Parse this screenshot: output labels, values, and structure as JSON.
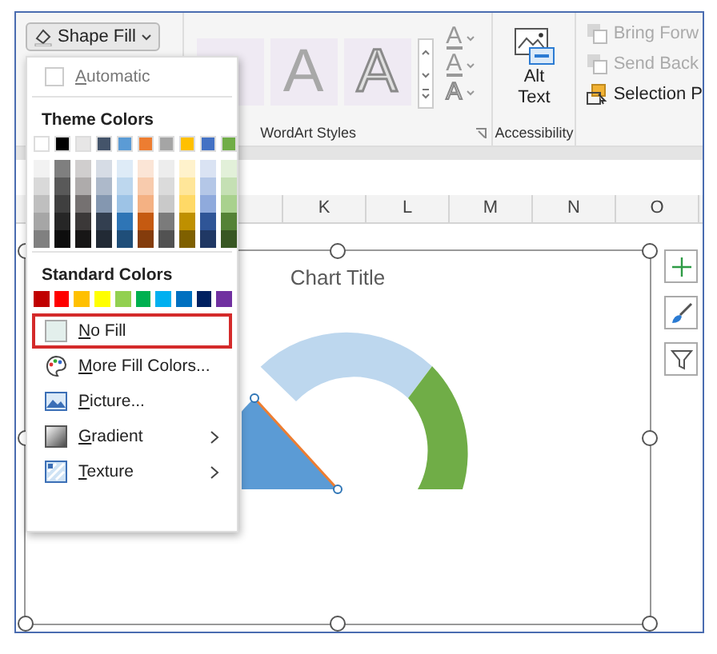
{
  "ribbon": {
    "shape_fill_button": {
      "label": "Shape Fill"
    },
    "wordart_tiles": [
      {
        "kind": "fill"
      },
      {
        "kind": "fill",
        "letter": "A"
      },
      {
        "kind": "outline",
        "letter": "A"
      }
    ],
    "text_effect_buttons": [
      {
        "letter": "A",
        "kind": "fill"
      },
      {
        "letter": "A",
        "kind": "outline"
      },
      {
        "letter": "A",
        "kind": "effects"
      }
    ],
    "group_labels": [
      "WordArt Styles",
      "Accessibility"
    ],
    "alt_text_button": {
      "lines": [
        "Alt",
        "Text"
      ]
    },
    "arrange_buttons": [
      {
        "label": "Bring Forw",
        "disabled": true
      },
      {
        "label": "Send Back",
        "disabled": true
      },
      {
        "label": "Selection P",
        "disabled": false
      }
    ]
  },
  "columns": [
    "K",
    "L",
    "M",
    "N",
    "O"
  ],
  "chart": {
    "title": "Chart Title"
  },
  "shape_fill_menu": {
    "automatic": {
      "label": "Automatic",
      "disabled": true
    },
    "theme_heading": "Theme Colors",
    "theme_colors": [
      {
        "color": "#ffffff",
        "shades": [
          {
            "color": "#f2f2f2"
          },
          {
            "color": "#d9d9d9"
          },
          {
            "color": "#bfbfbf"
          },
          {
            "color": "#a6a6a6"
          },
          {
            "color": "#808080"
          }
        ]
      },
      {
        "color": "#000000",
        "shades": [
          {
            "color": "#7f7f7f"
          },
          {
            "color": "#595959"
          },
          {
            "color": "#3f3f3f"
          },
          {
            "color": "#262626"
          },
          {
            "color": "#0d0d0d"
          }
        ]
      },
      {
        "color": "#e7e6e6",
        "shades": [
          {
            "color": "#d0cece"
          },
          {
            "color": "#aeabab"
          },
          {
            "color": "#757171"
          },
          {
            "color": "#3b3838"
          },
          {
            "color": "#171616"
          }
        ]
      },
      {
        "color": "#44546a",
        "shades": [
          {
            "color": "#d6dce5"
          },
          {
            "color": "#adb9ca"
          },
          {
            "color": "#8497b0"
          },
          {
            "color": "#333f50"
          },
          {
            "color": "#222a35"
          }
        ]
      },
      {
        "color": "#5b9bd5",
        "shades": [
          {
            "color": "#deebf7"
          },
          {
            "color": "#bdd7ee"
          },
          {
            "color": "#9dc3e6"
          },
          {
            "color": "#2e75b6"
          },
          {
            "color": "#1f4e79"
          }
        ]
      },
      {
        "color": "#ed7d31",
        "shades": [
          {
            "color": "#fbe5d6"
          },
          {
            "color": "#f8cbad"
          },
          {
            "color": "#f4b183"
          },
          {
            "color": "#c55a11"
          },
          {
            "color": "#843c0c"
          }
        ]
      },
      {
        "color": "#a5a5a5",
        "shades": [
          {
            "color": "#ededed"
          },
          {
            "color": "#dbdbdb"
          },
          {
            "color": "#c9c9c9"
          },
          {
            "color": "#7b7b7b"
          },
          {
            "color": "#525252"
          }
        ]
      },
      {
        "color": "#ffc000",
        "shades": [
          {
            "color": "#fff2cc"
          },
          {
            "color": "#ffe699"
          },
          {
            "color": "#ffd966"
          },
          {
            "color": "#bf9000"
          },
          {
            "color": "#7f6000"
          }
        ]
      },
      {
        "color": "#4472c4",
        "shades": [
          {
            "color": "#dae3f3"
          },
          {
            "color": "#b4c7e7"
          },
          {
            "color": "#8faadc"
          },
          {
            "color": "#2f5597"
          },
          {
            "color": "#203864"
          }
        ]
      },
      {
        "color": "#70ad47",
        "shades": [
          {
            "color": "#e2f0d9"
          },
          {
            "color": "#c5e0b4"
          },
          {
            "color": "#a9d18e"
          },
          {
            "color": "#548235"
          },
          {
            "color": "#385723"
          }
        ]
      }
    ],
    "standard_heading": "Standard Colors",
    "standard_colors": [
      {
        "color": "#c00000"
      },
      {
        "color": "#ff0000"
      },
      {
        "color": "#ffc000"
      },
      {
        "color": "#ffff00"
      },
      {
        "color": "#92d050"
      },
      {
        "color": "#00b050"
      },
      {
        "color": "#00b0f0"
      },
      {
        "color": "#0070c0"
      },
      {
        "color": "#002060"
      },
      {
        "color": "#7030a0"
      }
    ],
    "items": [
      {
        "kind": "no-fill",
        "label": "No Fill",
        "selected": true,
        "submenu": false
      },
      {
        "kind": "more-colors",
        "label": "More Fill Colors...",
        "selected": false,
        "submenu": false
      },
      {
        "kind": "picture",
        "label": "Picture...",
        "selected": false,
        "submenu": false
      },
      {
        "kind": "gradient",
        "label": "Gradient",
        "selected": false,
        "submenu": true
      },
      {
        "kind": "texture",
        "label": "Texture",
        "selected": false,
        "submenu": true
      }
    ]
  }
}
